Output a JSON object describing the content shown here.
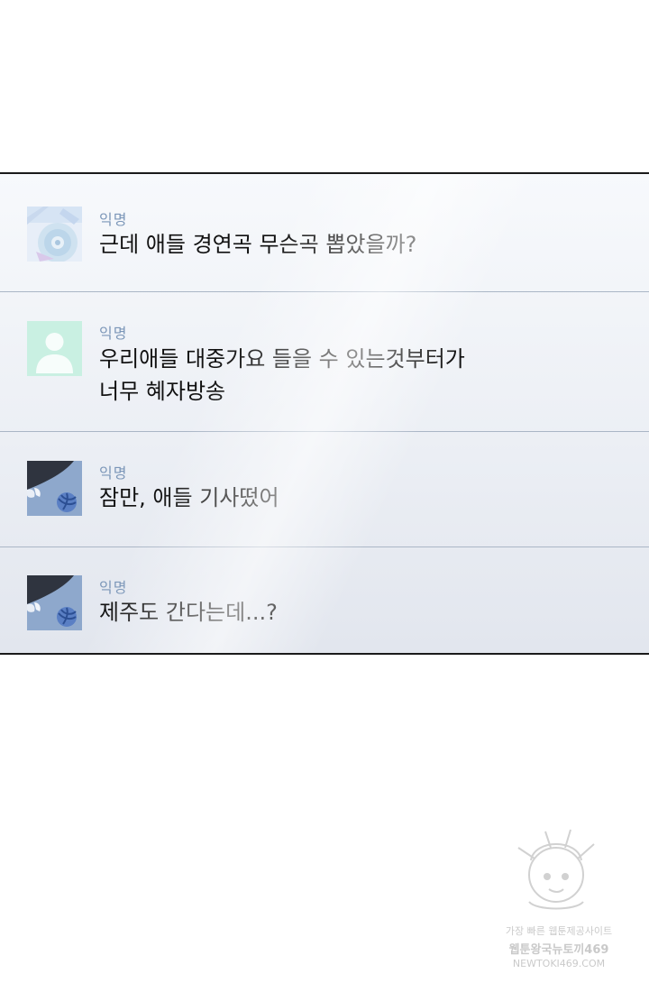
{
  "comments": [
    {
      "author": "익명",
      "avatar_icon": "disc-illustration-avatar-icon",
      "lines": [
        "근데 애들 경연곡 무슨곡 뽑았을까?"
      ]
    },
    {
      "author": "익명",
      "avatar_icon": "default-user-avatar-icon",
      "lines": [
        "우리애들 대중가요 들을 수 있는것부터가",
        "너무 혜자방송"
      ]
    },
    {
      "author": "익명",
      "avatar_icon": "yarn-ball-avatar-icon",
      "lines": [
        "잠만, 애들 기사떴어"
      ]
    },
    {
      "author": "익명",
      "avatar_icon": "yarn-ball-avatar-icon",
      "lines": [
        "제주도 간다는데...?"
      ]
    }
  ],
  "watermark": {
    "line1": "가장 빠른 웹툰제공사이트",
    "line2": "웹툰왕국뉴토끼469",
    "line3": "NEWTOKI469.COM"
  },
  "colors": {
    "author": "#7b96b8",
    "message": "#111111",
    "divider": "#aab6c6",
    "frame": "#1a1a1a"
  }
}
